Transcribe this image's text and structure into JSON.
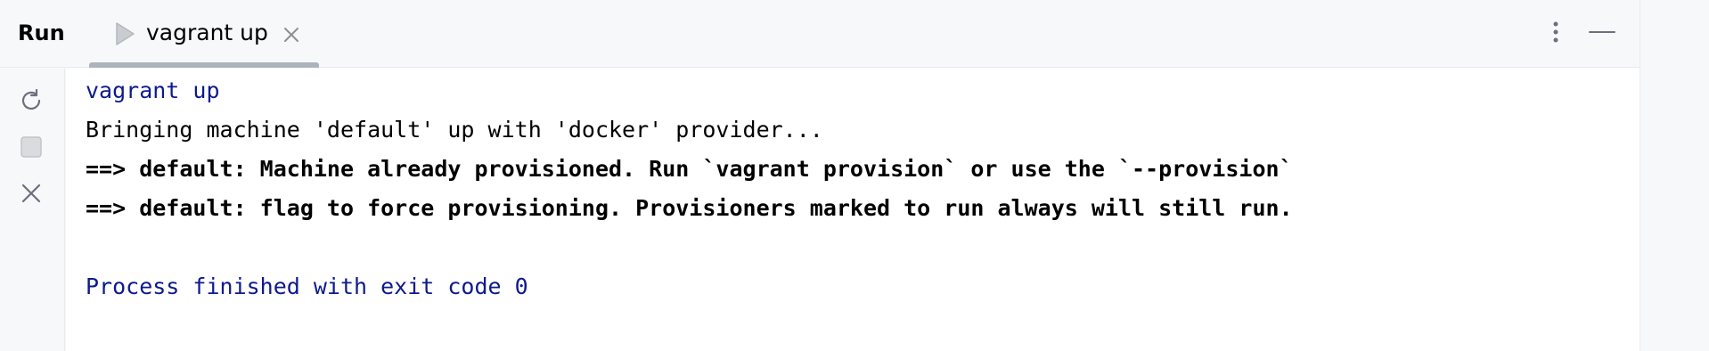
{
  "header": {
    "title": "Run",
    "tab": {
      "label": "vagrant up",
      "icon": "play-icon",
      "close_icon": "close-icon"
    },
    "actions": {
      "more_icon": "more-vertical-icon",
      "minimize_icon": "minimize-icon"
    }
  },
  "toolbar": {
    "items": [
      {
        "icon": "rerun-icon"
      },
      {
        "icon": "stop-icon"
      },
      {
        "icon": "close-icon"
      }
    ]
  },
  "console": {
    "lines": [
      "vagrant up",
      "Bringing machine 'default' up with 'docker' provider...",
      "==> default: Machine already provisioned. Run `vagrant provision` or use the `--provision`",
      "==> default: flag to force provisioning. Provisioners marked to run always will still run.",
      "",
      "Process finished with exit code 0"
    ]
  },
  "colors": {
    "command": "#0d1a8c",
    "output": "#000000",
    "background": "#ffffff",
    "chrome": "#f7f8fa"
  }
}
